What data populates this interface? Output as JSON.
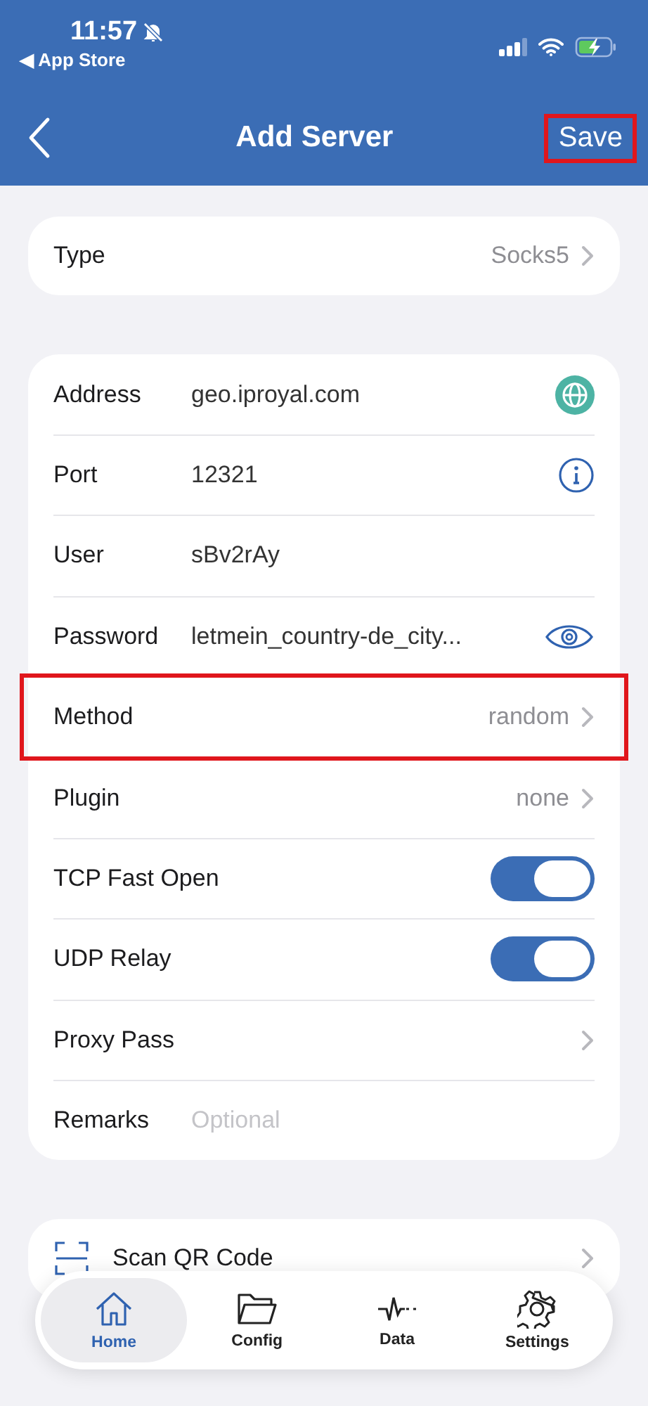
{
  "status_bar": {
    "time": "11:57",
    "back_link": "◀ App Store"
  },
  "nav_bar": {
    "title": "Add Server",
    "save": {
      "label": "Save",
      "highlighted": true
    }
  },
  "type_row": {
    "label": "Type",
    "value": "Socks5"
  },
  "rows": [
    {
      "kind": "globe_field",
      "label": "Address",
      "value": "geo.iproyal.com",
      "highlighted": false
    },
    {
      "kind": "info_field",
      "label": "Port",
      "value": "12321",
      "highlighted": false
    },
    {
      "kind": "field",
      "label": "User",
      "value": "sBv2rAy",
      "highlighted": false
    },
    {
      "kind": "secret_field",
      "label": "Password",
      "value": "letmein_country-de_city...",
      "highlighted": false
    },
    {
      "kind": "select",
      "label": "Method",
      "value": "random",
      "highlighted": true
    },
    {
      "kind": "select",
      "label": "Plugin",
      "value": "none",
      "highlighted": false
    },
    {
      "kind": "toggle",
      "label": "TCP Fast Open",
      "on": true,
      "highlighted": false
    },
    {
      "kind": "toggle",
      "label": "UDP Relay",
      "on": true,
      "highlighted": false
    },
    {
      "kind": "link",
      "label": "Proxy Pass",
      "highlighted": false
    },
    {
      "kind": "placeholder_field",
      "label": "Remarks",
      "placeholder": "Optional",
      "highlighted": false
    }
  ],
  "scan_row": {
    "label": "Scan QR Code"
  },
  "tab_bar": [
    {
      "kind": "home",
      "label": "Home",
      "selected": true
    },
    {
      "kind": "config",
      "label": "Config",
      "selected": false
    },
    {
      "kind": "data",
      "label": "Data",
      "selected": false
    },
    {
      "kind": "settings",
      "label": "Settings",
      "selected": false
    }
  ]
}
